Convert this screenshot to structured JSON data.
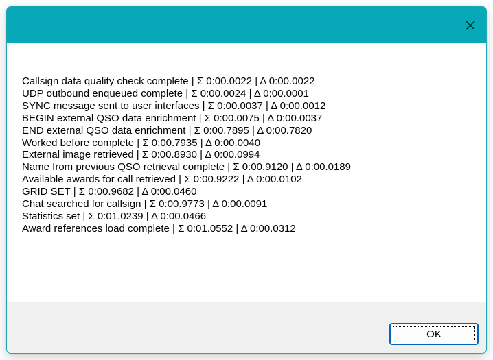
{
  "titlebar": {
    "color": "#07a8b7",
    "close_icon": "close-icon"
  },
  "log": {
    "lines": [
      "Callsign data quality check complete | Σ 0:00.0022 | Δ 0:00.0022",
      "UDP outbound enqueued complete | Σ 0:00.0024 | Δ 0:00.0001",
      "SYNC message sent to user interfaces | Σ 0:00.0037 | Δ 0:00.0012",
      "BEGIN external QSO data enrichment | Σ 0:00.0075 | Δ 0:00.0037",
      "END external QSO data enrichment | Σ 0:00.7895 | Δ 0:00.7820",
      "Worked before complete | Σ 0:00.7935 | Δ 0:00.0040",
      "External image retrieved | Σ 0:00.8930 | Δ 0:00.0994",
      "Name from previous QSO retrieval complete | Σ 0:00.9120 | Δ 0:00.0189",
      "Available awards for call retrieved | Σ 0:00.9222 | Δ 0:00.0102",
      "GRID SET | Σ 0:00.9682 | Δ 0:00.0460",
      "Chat searched for callsign | Σ 0:00.9773 | Δ 0:00.0091",
      "Statistics set | Σ 0:01.0239 | Δ 0:00.0466",
      "Award references load complete | Σ 0:01.0552 | Δ 0:00.0312"
    ]
  },
  "footer": {
    "ok_label": "OK"
  }
}
